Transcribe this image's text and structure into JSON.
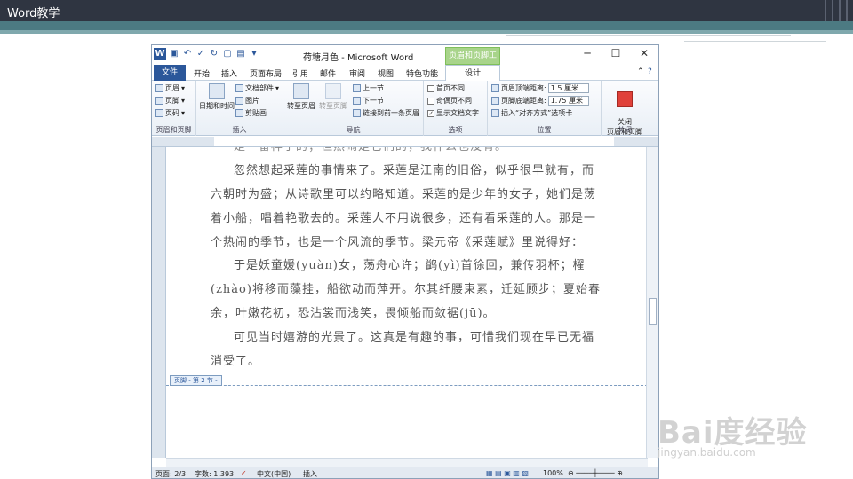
{
  "slide": {
    "title": "Word教学"
  },
  "window": {
    "title": "荷塘月色 - Microsoft Word",
    "context_tab_title": "页眉和页脚工具",
    "controls": {
      "minimize": "─",
      "maximize": "☐",
      "close": "✕"
    }
  },
  "tabs": [
    "开始",
    "插入",
    "页面布局",
    "引用",
    "邮件",
    "审阅",
    "视图",
    "特色功能"
  ],
  "file_tab": "文件",
  "design_tab": "设计",
  "ribbon": {
    "header_footer": {
      "label": "页眉和页脚",
      "items": [
        "页眉",
        "页脚",
        "页码"
      ]
    },
    "insert": {
      "label": "插入",
      "datetime": "日期和时间",
      "items": [
        "文档部件",
        "图片",
        "剪贴画"
      ]
    },
    "nav": {
      "label": "导航",
      "goto_header": "转至页眉",
      "goto_footer": "转至页脚",
      "items": [
        "上一节",
        "下一节",
        "链接到前一条页眉"
      ]
    },
    "options": {
      "label": "选项",
      "items": [
        {
          "text": "首页不同",
          "checked": false
        },
        {
          "text": "奇偶页不同",
          "checked": false
        },
        {
          "text": "显示文档文字",
          "checked": true
        }
      ]
    },
    "position": {
      "label": "位置",
      "header_dist_label": "页眉顶端距离:",
      "header_dist": "1.5 厘米",
      "footer_dist_label": "页脚底端距离:",
      "footer_dist": "1.75 厘米",
      "insert_align": "插入“对齐方式”选项卡"
    },
    "close": {
      "label": "关闭",
      "button": "关闭\n页眉和页脚"
    }
  },
  "document": {
    "partial_top": "是一番样子的；但热闹是它们的，我什么也没有。",
    "paragraphs": [
      "忽然想起采莲的事情来了。采莲是江南的旧俗，似乎很早就有，而六朝时为盛；从诗歌里可以约略知道。采莲的是少年的女子，她们是荡着小船，唱着艳歌去的。采莲人不用说很多，还有看采莲的人。那是一个热闹的季节，也是一个风流的季节。梁元帝《采莲赋》里说得好：",
      "于是妖童媛(yuàn)女，荡舟心许；鹢(yì)首徐回，兼传羽杯；櫂(zhào)将移而藻挂，船欲动而萍开。尔其纤腰束素，迁延顾步；夏始春余，叶嫩花初，恐沾裳而浅笑，畏倾船而敛裾(jū)。",
      "可见当时嬉游的光景了。这真是有趣的事，可惜我们现在早已无福消受了。"
    ],
    "footer_tag": "页脚 - 第 2 节 -"
  },
  "status": {
    "page": "页面: 2/3",
    "words": "字数: 1,393",
    "lang": "中文(中国)",
    "mode": "插入",
    "zoom": "100%"
  },
  "watermark": {
    "line1": "Bai度经验",
    "line2": "jingyan.baidu.com"
  }
}
